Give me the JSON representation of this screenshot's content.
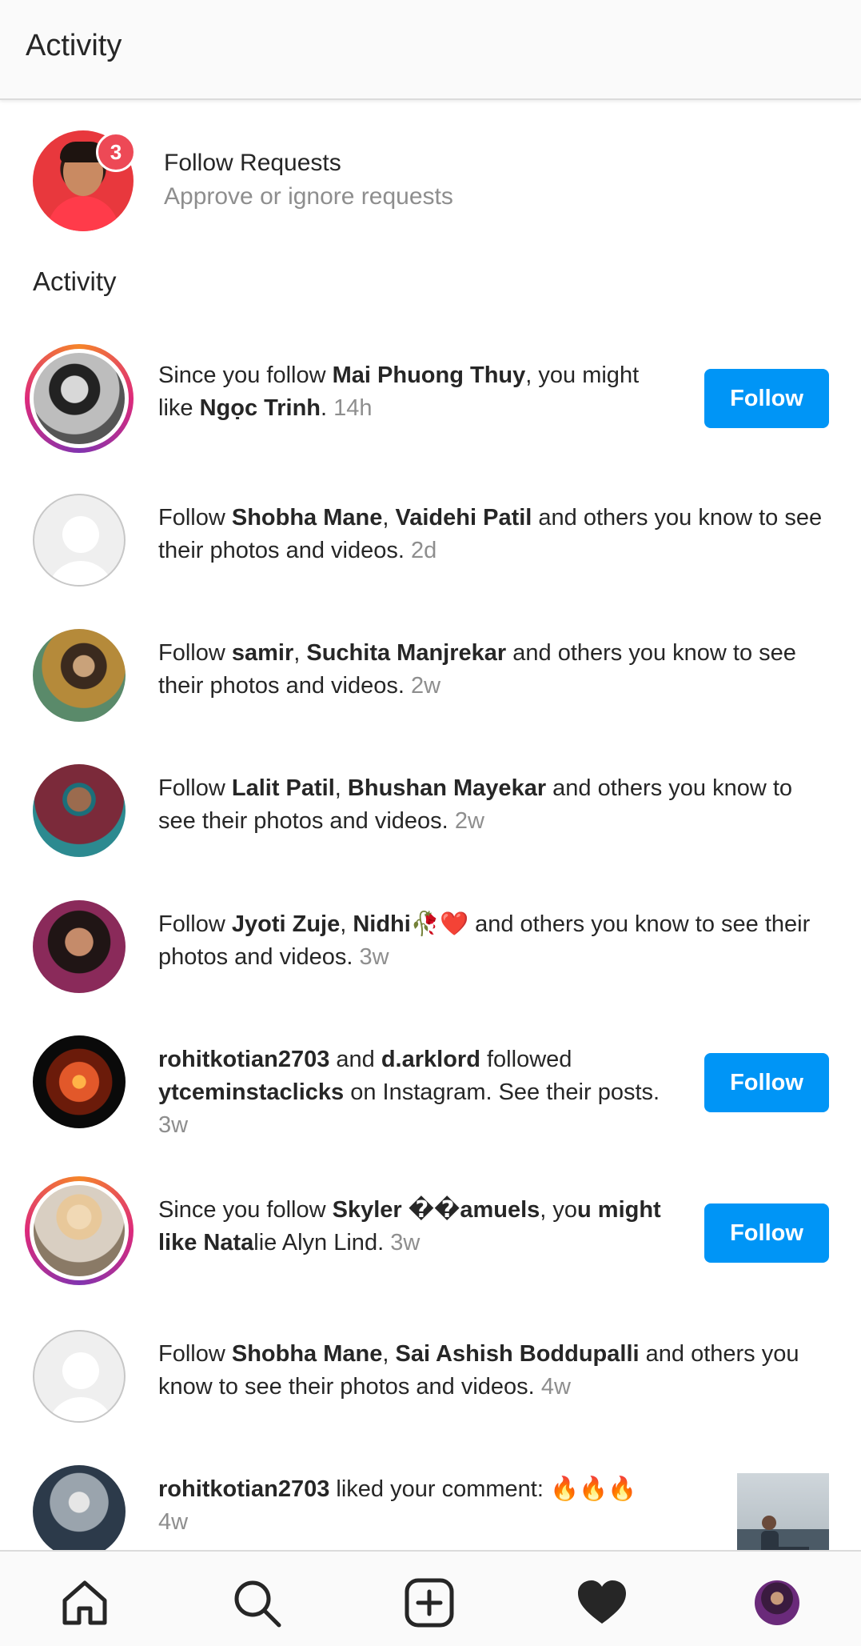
{
  "header": {
    "title": "Activity"
  },
  "follow_requests": {
    "count": "3",
    "title": "Follow Requests",
    "subtitle": "Approve or ignore requests"
  },
  "section_title": "Activity",
  "items": [
    {
      "parts": [
        "Since you follow ",
        "Mai Phuong Thuy",
        ", you might like ",
        "Ngọc Trinh",
        ". "
      ],
      "time": "14h",
      "button": "Follow"
    },
    {
      "parts": [
        "Follow ",
        "Shobha Mane",
        ", ",
        "Vaidehi Patil",
        " and others you know to see their photos and videos. "
      ],
      "time": "2d"
    },
    {
      "parts": [
        "Follow ",
        "samir",
        ", ",
        "Suchita Manjrekar",
        " and others you know to see their photos and videos. "
      ],
      "time": "2w"
    },
    {
      "parts": [
        "Follow ",
        "Lalit Patil",
        ", ",
        "Bhushan Mayekar",
        " and others you know to see their photos and videos. "
      ],
      "time": "2w"
    },
    {
      "parts": [
        "Follow ",
        "Jyoti Zuje",
        ", ",
        "Nidhi🥀❤️",
        " and others you know to see their photos and videos. "
      ],
      "time": "3w"
    },
    {
      "parts": [
        "rohitkotian2703",
        " and ",
        "d.arklord",
        " followed ",
        "ytceminstaclicks",
        " on Instagram. See their posts. "
      ],
      "time": "3w",
      "button": "Follow"
    },
    {
      "parts": [
        "Since you follow ",
        "Skyler ��amuels",
        ", yo",
        "u might like Nata",
        "lie Alyn Lind. "
      ],
      "time": "3w",
      "button": "Follow"
    },
    {
      "parts": [
        "Follow ",
        "Shobha Mane",
        ", ",
        "Sai Ashish Boddupalli",
        " and others you know to see their photos and videos. "
      ],
      "time": "4w"
    },
    {
      "parts": [
        "rohitkotian2703",
        " liked your comment: 🔥🔥🔥"
      ],
      "time": "4w"
    }
  ],
  "nav": {
    "home": "home-icon",
    "search": "search-icon",
    "create": "add-post-icon",
    "activity": "heart-icon",
    "profile": "profile-avatar"
  },
  "colors": {
    "primary": "#0095f6",
    "badge": "#ed4956",
    "muted": "#8e8e8e",
    "text": "#262626"
  }
}
